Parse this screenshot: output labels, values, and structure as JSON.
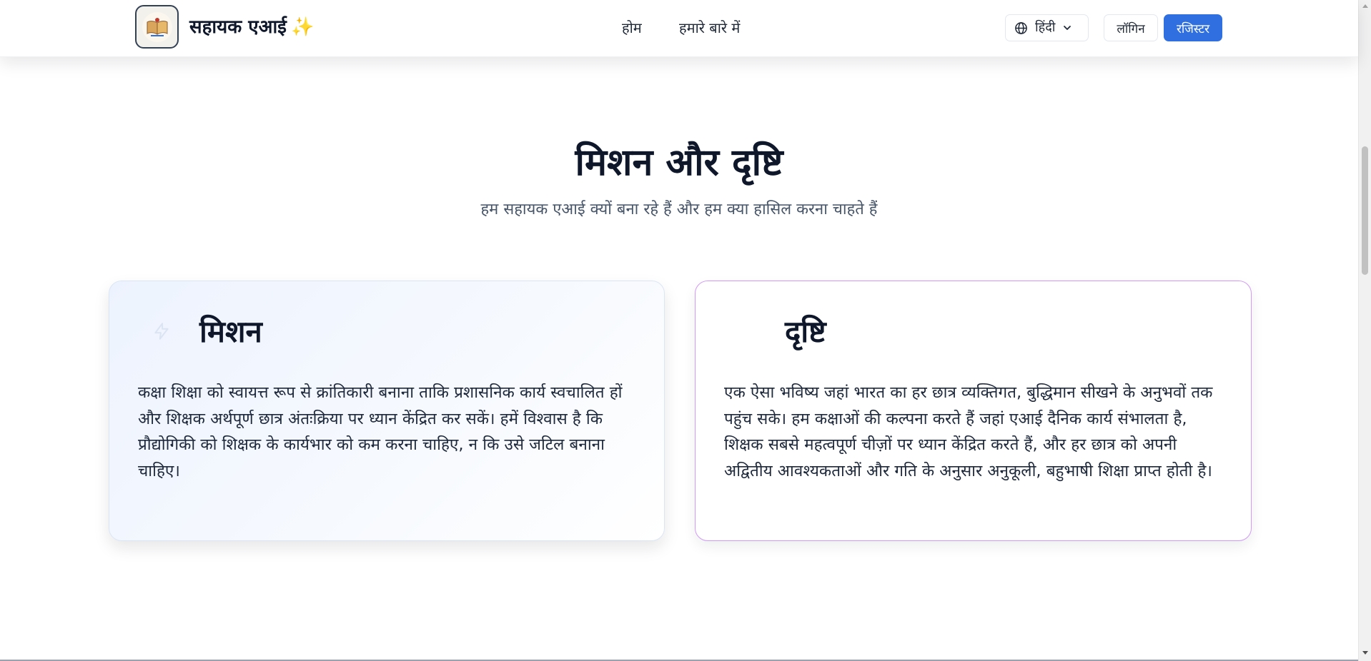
{
  "header": {
    "brand_name": "सहायक एआई",
    "brand_sparkle": "✨",
    "nav": {
      "home": "होम",
      "about": "हमारे बारे में"
    },
    "language": {
      "selected": "हिंदी",
      "icon": "globe-icon"
    },
    "login_label": "लॉगिन",
    "register_label": "रजिस्टर"
  },
  "section": {
    "title": "मिशन और दृष्टि",
    "subtitle": "हम सहायक एआई क्यों बना रहे हैं और हम क्या हासिल करना चाहते हैं"
  },
  "cards": {
    "mission": {
      "icon": "lightning-icon",
      "title": "मिशन",
      "body": "कक्षा शिक्षा को स्वायत्त रूप से क्रांतिकारी बनाना ताकि प्रशासनिक कार्य स्वचालित हों और शिक्षक अर्थपूर्ण छात्र अंतःक्रिया पर ध्यान केंद्रित कर सकें। हमें विश्वास है कि प्रौद्योगिकी को शिक्षक के कार्यभार को कम करना चाहिए, न कि उसे जटिल बनाना चाहिए।"
    },
    "vision": {
      "icon": "eye-icon",
      "title": "दृष्टि",
      "body": "एक ऐसा भविष्य जहां भारत का हर छात्र व्यक्तिगत, बुद्धिमान सीखने के अनुभवों तक पहुंच सके। हम कक्षाओं की कल्पना करते हैं जहां एआई दैनिक कार्य संभालता है, शिक्षक सबसे महत्वपूर्ण चीज़ों पर ध्यान केंद्रित करते हैं, और हर छात्र को अपनी अद्वितीय आवश्यकताओं और गति के अनुसार अनुकूली, बहुभाषी शिक्षा प्राप्त होती है।"
    }
  },
  "colors": {
    "primary": "#2f6fdf",
    "vision_border": "#d29af5",
    "mission_bg": "#edf3fe",
    "heading": "#0f172a"
  }
}
